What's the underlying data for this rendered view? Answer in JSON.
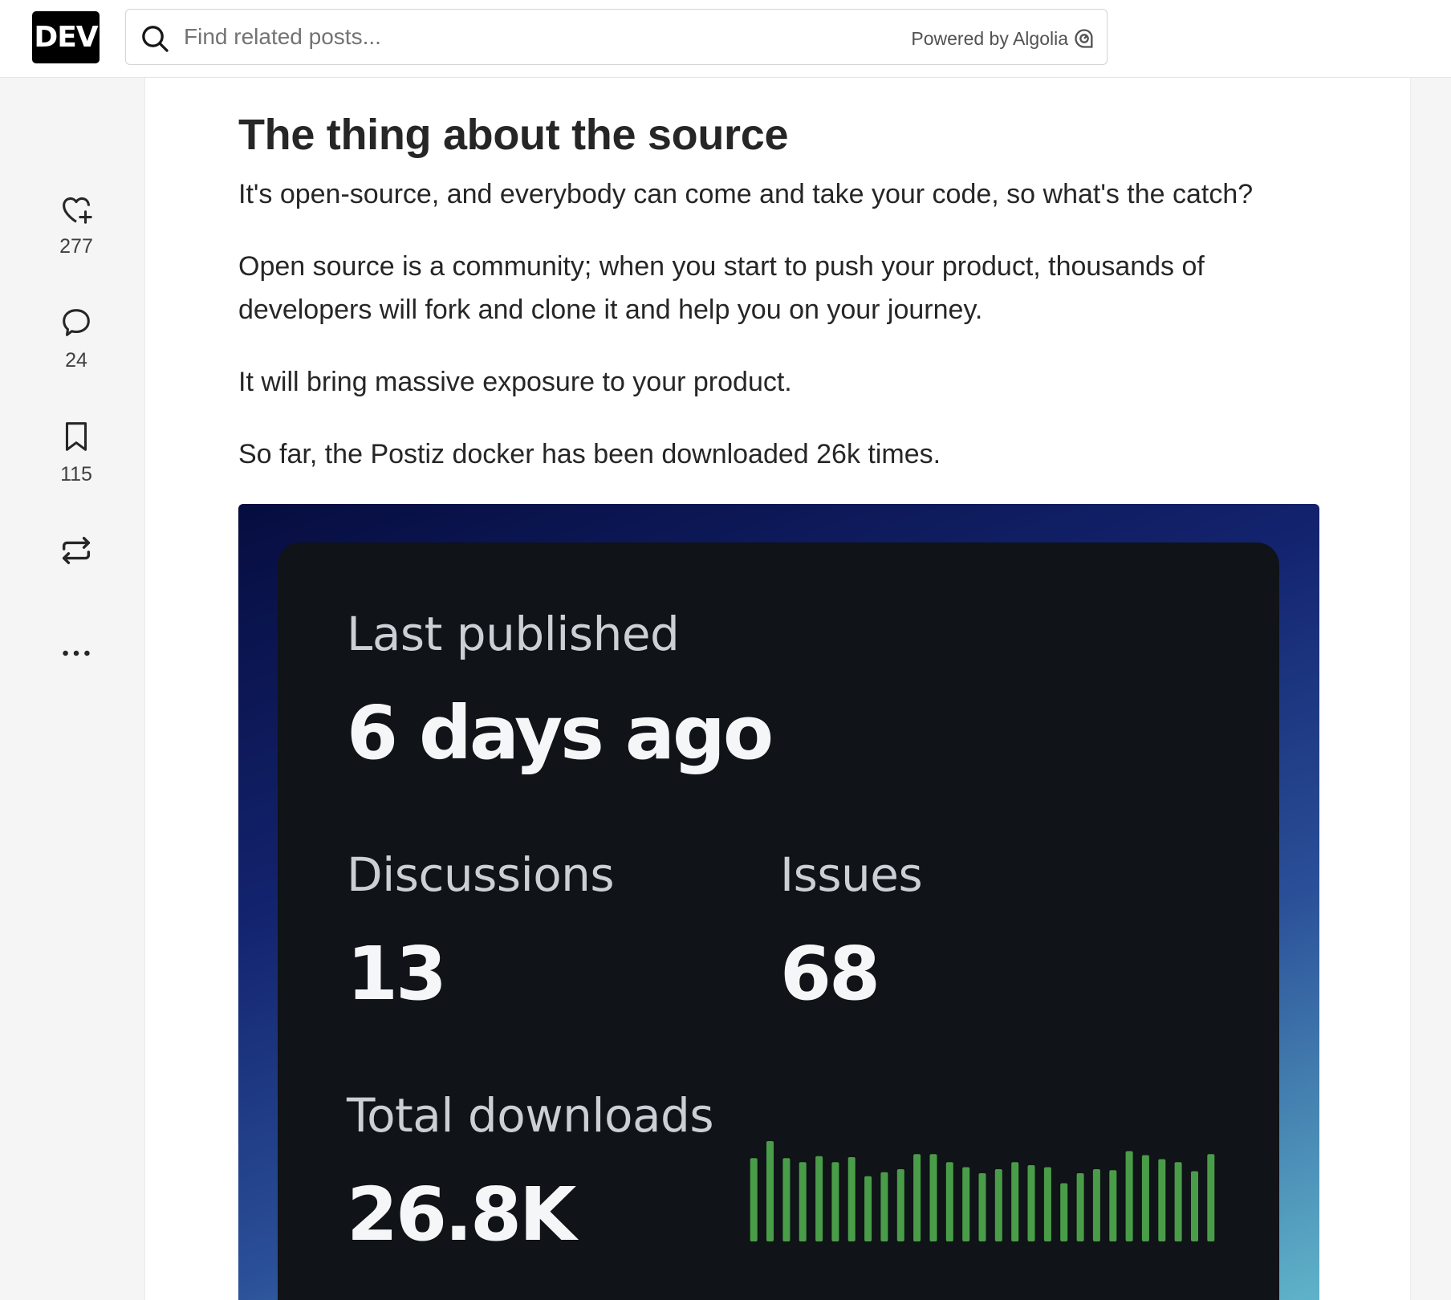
{
  "header": {
    "logo_text": "DEV",
    "search_placeholder": "Find related posts...",
    "powered_by": "Powered by Algolia"
  },
  "sidebar": {
    "reactions_count": "277",
    "comments_count": "24",
    "bookmarks_count": "115"
  },
  "article": {
    "title": "The thing about the source",
    "paragraphs": [
      "It's open-source, and everybody can come and take your code, so what's the catch?",
      "Open source is a community; when you start to push your product, thousands of developers will fork and clone it and help you on your journey.",
      "It will bring massive exposure to your product.",
      "So far, the Postiz docker has been downloaded 26k times."
    ]
  },
  "stats_card": {
    "last_published_label": "Last published",
    "last_published_value": "6 days ago",
    "discussions_label": "Discussions",
    "discussions_value": "13",
    "issues_label": "Issues",
    "issues_value": "68",
    "downloads_label": "Total downloads",
    "downloads_value": "26.8K",
    "sparkline_color": "#4a9d48",
    "sparkline_values": [
      0.83,
      1.0,
      0.83,
      0.79,
      0.85,
      0.79,
      0.84,
      0.65,
      0.69,
      0.72,
      0.87,
      0.87,
      0.79,
      0.74,
      0.68,
      0.72,
      0.79,
      0.76,
      0.74,
      0.58,
      0.68,
      0.72,
      0.71,
      0.9,
      0.86,
      0.82,
      0.79,
      0.7,
      0.87
    ]
  },
  "colors": {
    "brand": "#000000",
    "card_background": "#101317"
  }
}
